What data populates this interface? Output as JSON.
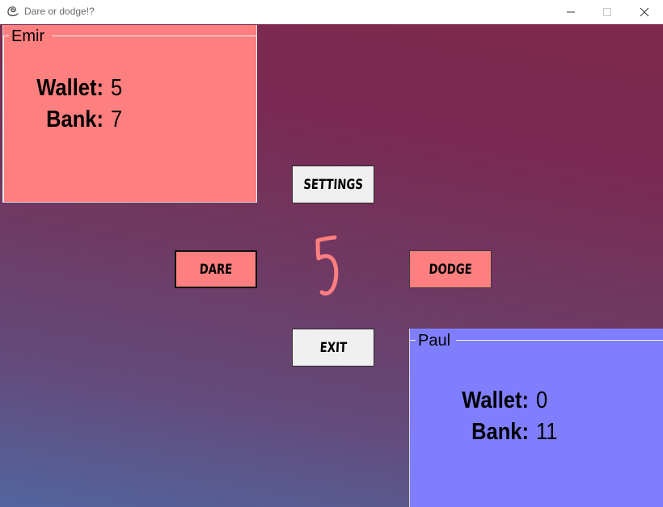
{
  "window": {
    "title": "Dare or dodge!?"
  },
  "players": {
    "emir": {
      "name": "Emir",
      "wallet_label": "Wallet:",
      "wallet_value": "5",
      "bank_label": "Bank:",
      "bank_value": "7",
      "color": "#fe7f7f"
    },
    "paul": {
      "name": "Paul",
      "wallet_label": "Wallet:",
      "wallet_value": "0",
      "bank_label": "Bank:",
      "bank_value": "11",
      "color": "#7f7ffe"
    }
  },
  "buttons": {
    "settings": "SETTINGS",
    "dare": "DARE",
    "dodge": "DODGE",
    "exit": "EXIT"
  },
  "counter": {
    "value": "5",
    "color": "#fe7f7f"
  },
  "icons": {
    "app": "app-logo-icon",
    "minimize": "minimize-icon",
    "maximize": "maximize-icon",
    "close": "close-icon"
  }
}
